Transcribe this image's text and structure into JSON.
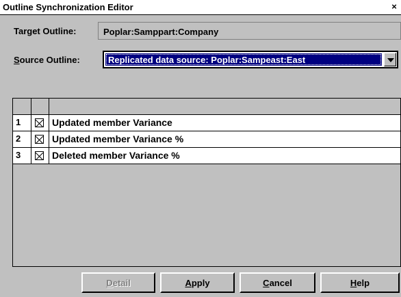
{
  "window": {
    "title": "Outline Synchronization Editor",
    "close_glyph": "×"
  },
  "target": {
    "label": "Target Outline:",
    "value": "Poplar:Samppart:Company"
  },
  "source": {
    "label_accel": "S",
    "label_rest": "ource Outline:",
    "selected": "Replicated data source: Poplar:Sampeast:East"
  },
  "rows": [
    {
      "num": "1",
      "checked": true,
      "text": "Updated member Variance"
    },
    {
      "num": "2",
      "checked": true,
      "text": "Updated member Variance %"
    },
    {
      "num": "3",
      "checked": true,
      "text": "Deleted member Variance %"
    }
  ],
  "buttons": {
    "detail": {
      "accel": "D",
      "rest": "etail",
      "enabled": false
    },
    "apply": {
      "accel": "A",
      "rest": "pply"
    },
    "cancel": {
      "accel": "C",
      "rest": "ancel"
    },
    "help": {
      "accel": "H",
      "rest": "elp"
    }
  }
}
